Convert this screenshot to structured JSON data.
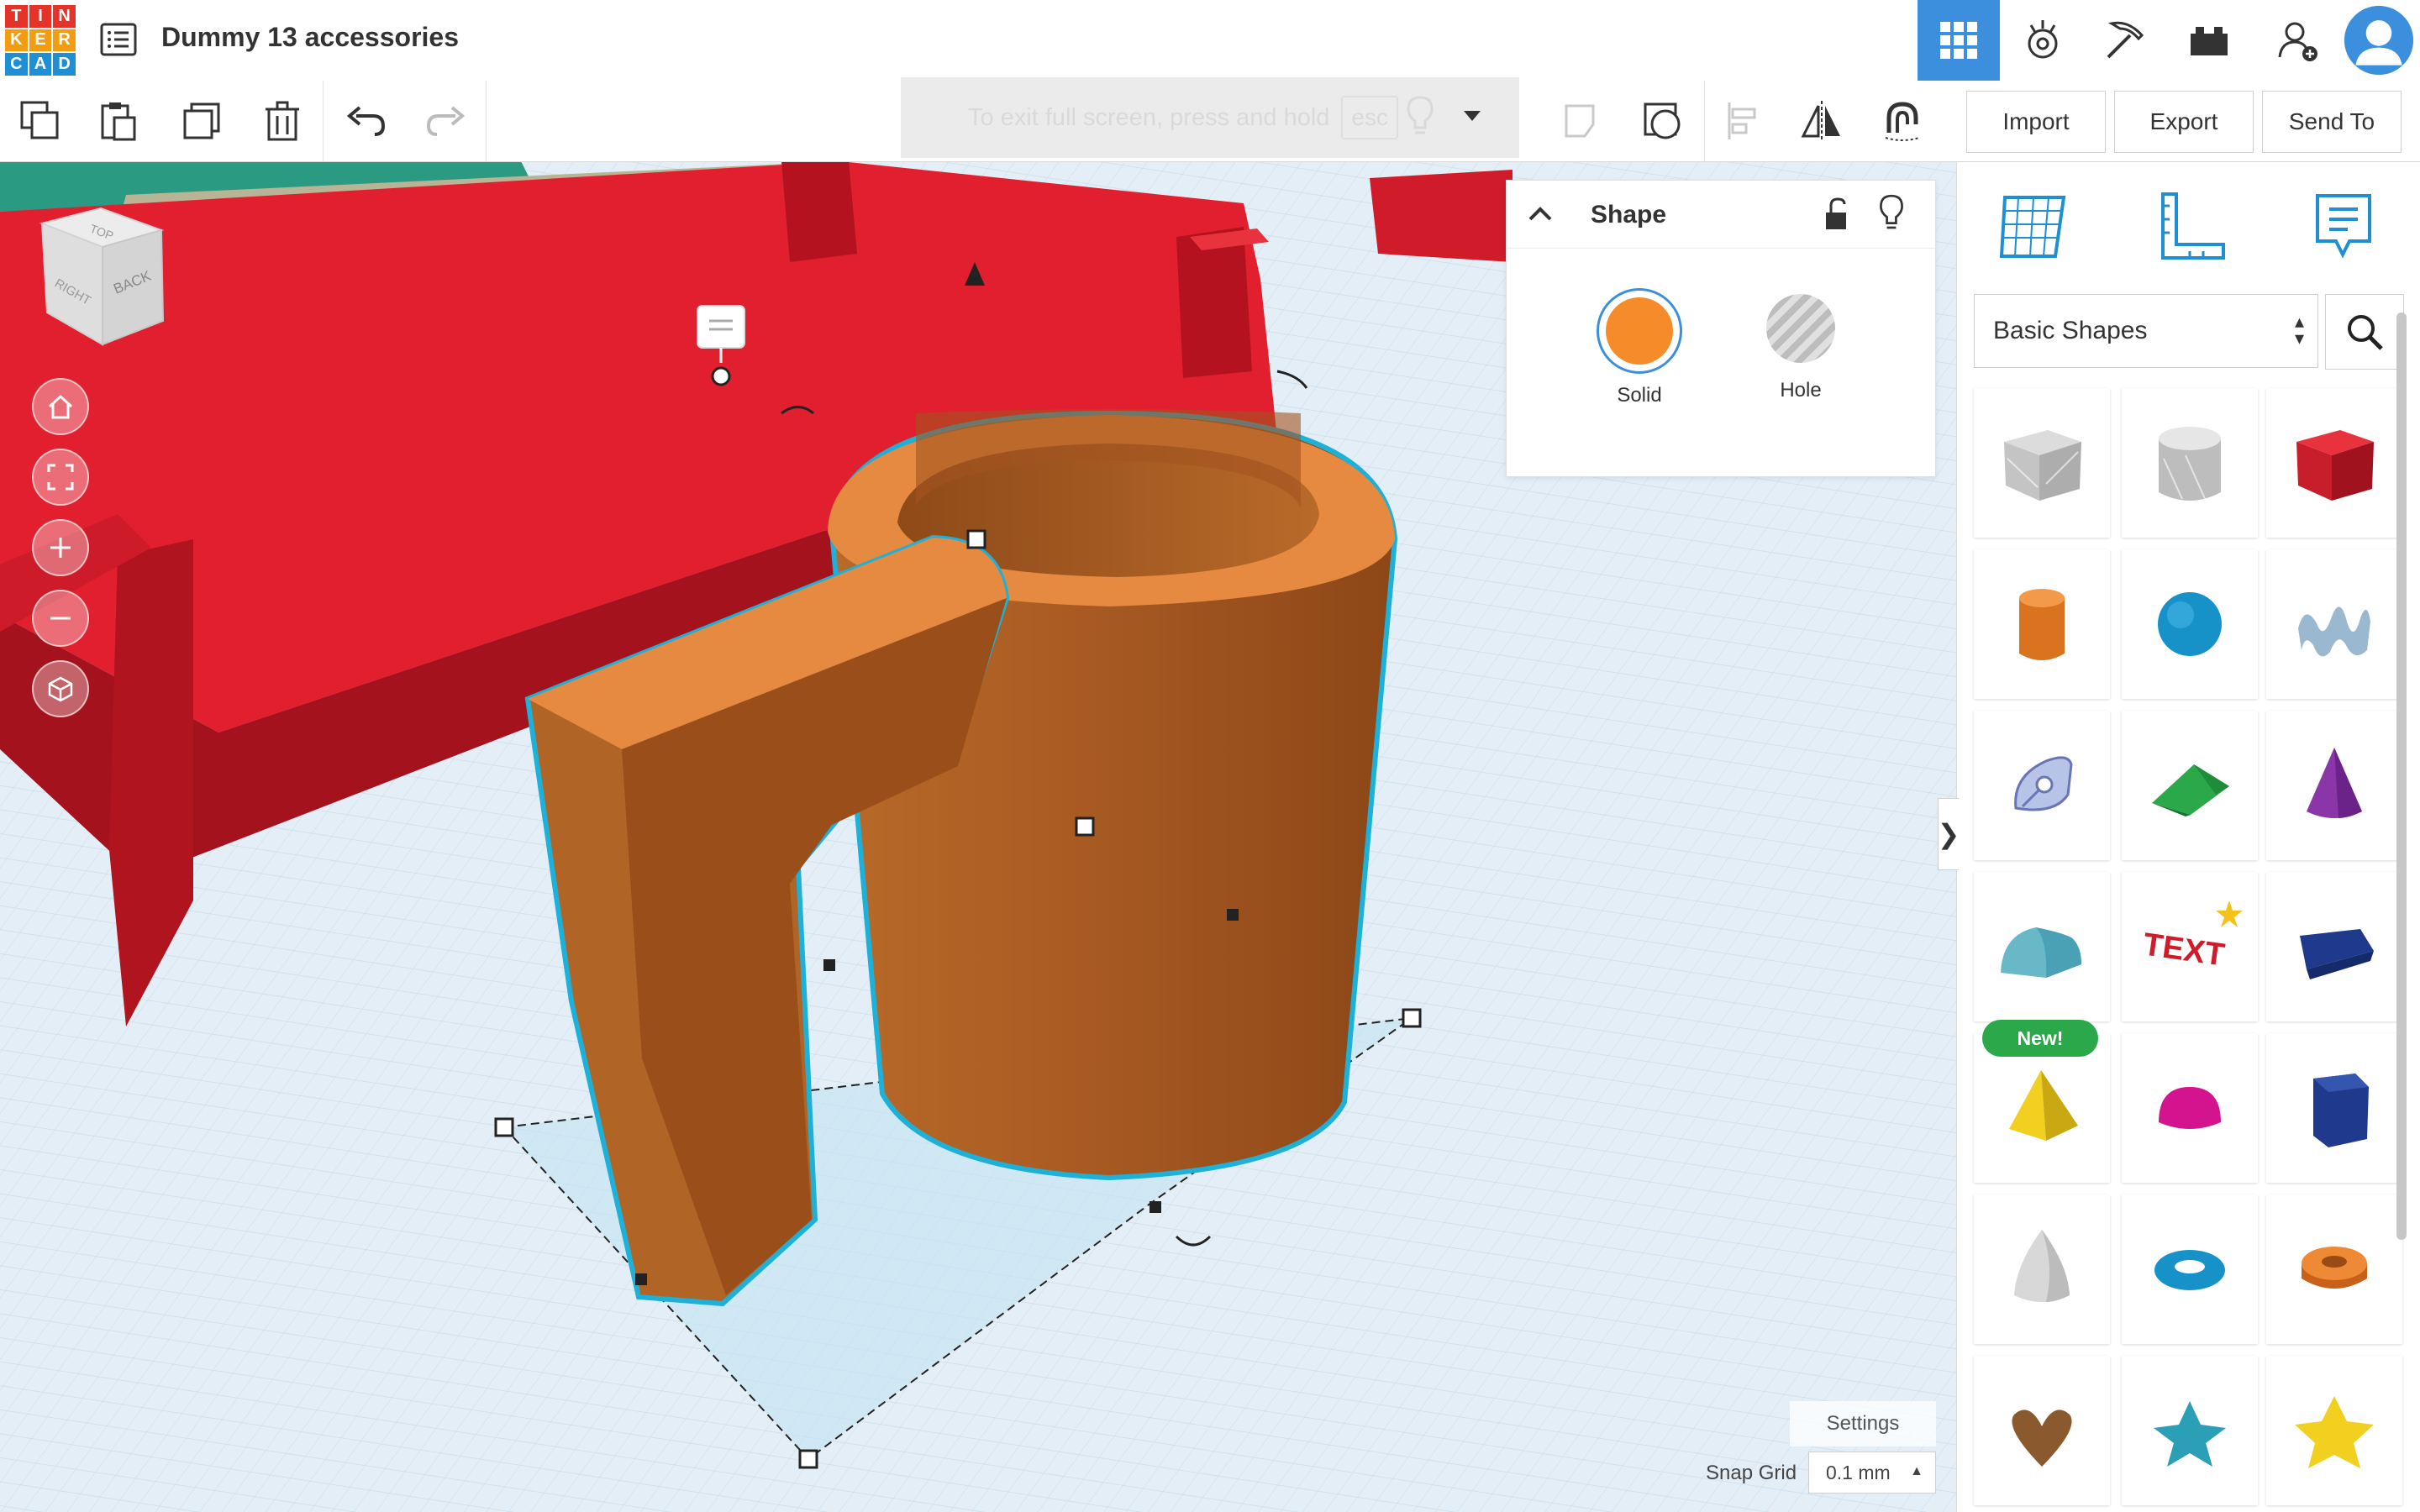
{
  "header": {
    "logo_letters": [
      "T",
      "I",
      "N",
      "K",
      "E",
      "R",
      "C",
      "A",
      "D"
    ],
    "logo_colors": [
      "#e5332a",
      "#e5332a",
      "#e5332a",
      "#f29c12",
      "#f29c12",
      "#f29c12",
      "#1e8fd5",
      "#1e8fd5",
      "#1e8fd5"
    ],
    "doc_title": "Dummy 13 accessories",
    "nav": [
      {
        "name": "3d-design-grid-icon",
        "active": true
      },
      {
        "name": "sim-lab-icon",
        "active": false
      },
      {
        "name": "minecraft-pickaxe-icon",
        "active": false
      },
      {
        "name": "bricks-icon",
        "active": false
      },
      {
        "name": "invite-user-icon",
        "active": false
      },
      {
        "name": "user-avatar-icon",
        "active": false
      }
    ]
  },
  "toolbar": {
    "left_icons": [
      "copy-icon",
      "paste-icon",
      "duplicate-icon",
      "delete-icon",
      "undo-icon",
      "redo-icon"
    ],
    "right_icons": [
      "note-icon",
      "view-shape-icon",
      "align-icon",
      "mirror-icon",
      "magnet-icon"
    ],
    "fullscreen_hint": "To exit full screen, press and hold",
    "fullscreen_key": "esc",
    "import_label": "Import",
    "export_label": "Export",
    "sendto_label": "Send To"
  },
  "viewport": {
    "view_cube": {
      "top": "TOP",
      "right": "RIGHT",
      "back": "BACK"
    },
    "nav_icons": [
      "home-view-icon",
      "fit-view-icon",
      "zoom-in-icon",
      "zoom-out-icon",
      "ortho-view-icon"
    ]
  },
  "inspector": {
    "title": "Shape",
    "solid_label": "Solid",
    "hole_label": "Hole",
    "solid_color": "#f68b2a"
  },
  "panel": {
    "tools": [
      "workplane-icon",
      "ruler-icon",
      "notes-icon"
    ],
    "library_label": "Basic Shapes",
    "new_badge": "New!",
    "shapes": [
      "box-hole-icon",
      "cylinder-hole-icon",
      "box-icon",
      "cylinder-icon",
      "sphere-icon",
      "scribble-icon",
      "shape-generator-icon",
      "roof-icon",
      "cone-icon",
      "round-roof-icon",
      "text-icon",
      "wedge-icon",
      "pyramid-icon",
      "half-sphere-icon",
      "polygon-icon",
      "paraboloid-icon",
      "torus-icon",
      "tube-icon",
      "heart-icon",
      "star-shape-icon",
      "star-icon"
    ],
    "text_shape_text": "TEXT"
  },
  "footer": {
    "settings_label": "Settings",
    "snap_label": "Snap Grid",
    "snap_value": "0.1 mm"
  }
}
